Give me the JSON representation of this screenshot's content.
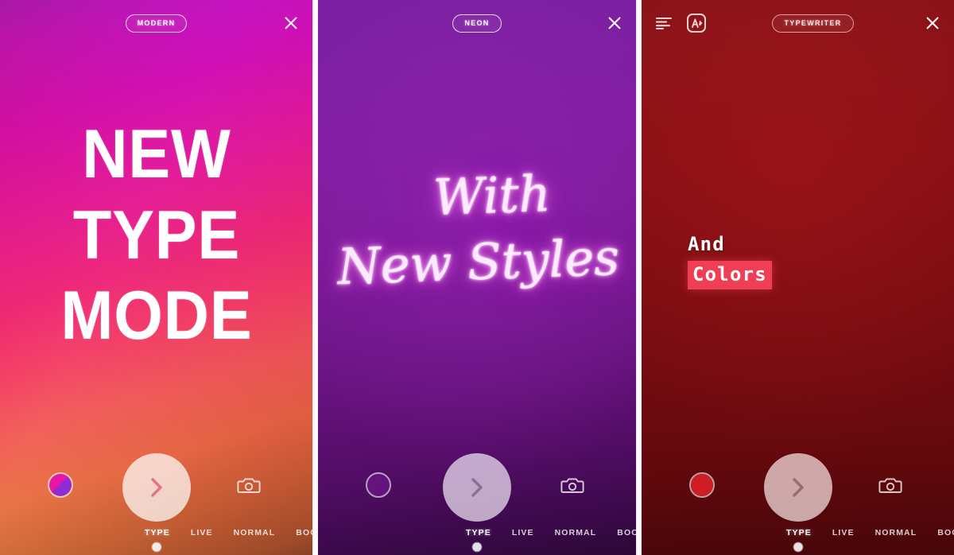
{
  "panels": [
    {
      "id": "modern",
      "style_label": "MODERN",
      "close_icon": "close-icon",
      "artwork": {
        "lines": [
          "NEW",
          "TYPE",
          "MODE"
        ],
        "text_color": "#ffffff"
      },
      "background": {
        "description": "magenta-to-orange diagonal gradient",
        "from": "#a81bc8",
        "mid": "#ee2a7b",
        "to": "#8f5228"
      },
      "controls": {
        "color_swatch": "color-swatch",
        "shutter_icon": "chevron-right-icon",
        "flip_camera_icon": "camera-flip-icon"
      },
      "modes": [
        "TYPE",
        "LIVE",
        "NORMAL",
        "BOOMERANG"
      ],
      "active_mode": "TYPE"
    },
    {
      "id": "neon",
      "style_label": "NEON",
      "close_icon": "close-icon",
      "artwork": {
        "lines": [
          "With",
          "New Styles"
        ],
        "text_color": "#fde9ff",
        "glow_color": "#e46ae0"
      },
      "background": {
        "description": "purple vertical gradient",
        "from": "#7b1fa0",
        "mid": "#6f168a",
        "to": "#2c0736"
      },
      "controls": {
        "color_swatch": "color-swatch",
        "shutter_icon": "chevron-right-icon",
        "flip_camera_icon": "camera-flip-icon"
      },
      "modes": [
        "TYPE",
        "LIVE",
        "NORMAL",
        "BOOMERANG"
      ],
      "active_mode": "TYPE"
    },
    {
      "id": "typewriter",
      "style_label": "TYPEWRITER",
      "close_icon": "close-icon",
      "toolbar": {
        "align_icon": "text-align-left-icon",
        "highlight_icon": "text-highlight-icon"
      },
      "artwork": {
        "lines": [
          "And",
          "Colors"
        ],
        "text_color": "#ffffff",
        "highlight_color": "#ef3e55",
        "highlighted_line": "Colors"
      },
      "background": {
        "description": "dark red gradient",
        "from": "#871319",
        "mid": "#720b10",
        "to": "#47060a"
      },
      "controls": {
        "color_swatch": "color-swatch",
        "shutter_icon": "chevron-right-icon",
        "flip_camera_icon": "camera-flip-icon"
      },
      "modes": [
        "TYPE",
        "LIVE",
        "NORMAL",
        "BOOMERANG"
      ],
      "active_mode": "TYPE"
    }
  ]
}
